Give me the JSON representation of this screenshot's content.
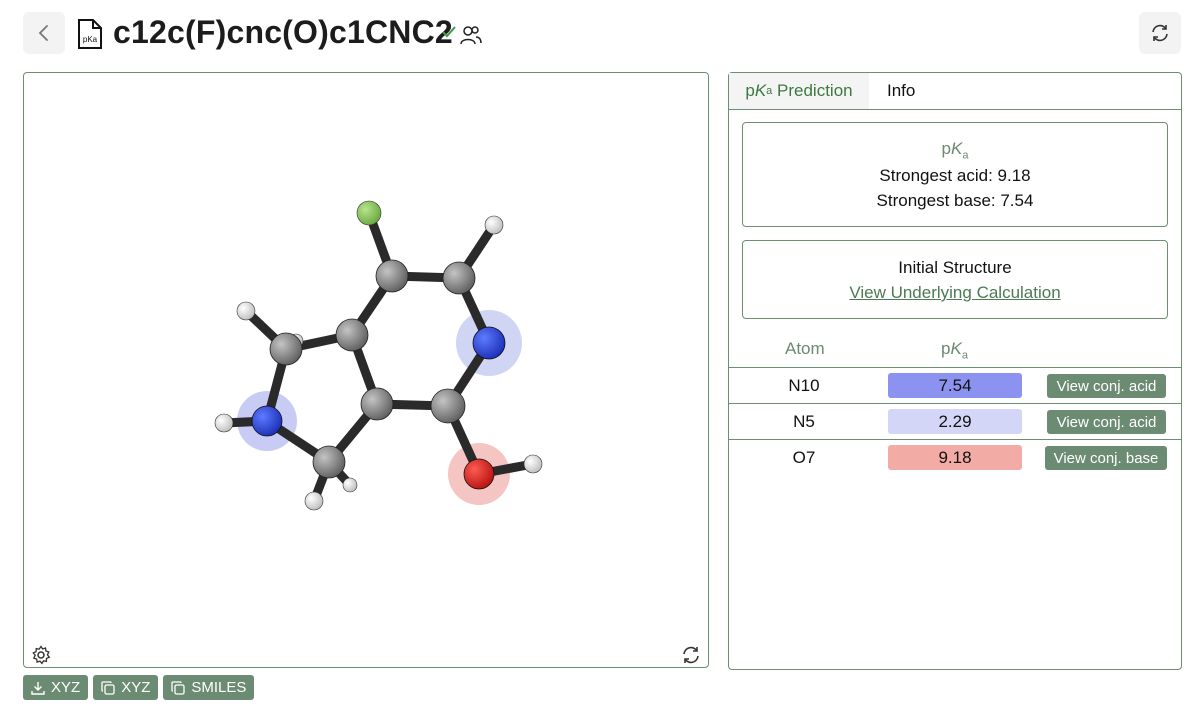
{
  "header": {
    "title": "c12c(F)cnc(O)c1CNC2",
    "file_icon_text": "pKa"
  },
  "bottom_buttons": [
    {
      "label": "XYZ",
      "icon": "download-icon"
    },
    {
      "label": "XYZ",
      "icon": "copy-icon"
    },
    {
      "label": "SMILES",
      "icon": "copy-icon"
    }
  ],
  "tabs": {
    "active_prefix": "p",
    "active_k": "K",
    "active_sub": "a",
    "active_suffix": " Prediction",
    "info": "Info"
  },
  "summary": {
    "head_p": "p",
    "head_k": "K",
    "head_sub": "a",
    "strongest_acid": "Strongest acid: 9.18",
    "strongest_base": "Strongest base: 7.54"
  },
  "initial": {
    "title": "Initial Structure",
    "link": "View Underlying Calculation"
  },
  "table": {
    "col_atom": "Atom",
    "col_pka_p": "p",
    "col_pka_k": "K",
    "col_pka_sub": "a",
    "rows": [
      {
        "atom": "N10",
        "pka": "7.54",
        "pill_color": "#8c92f0",
        "action": "View conj. acid"
      },
      {
        "atom": "N5",
        "pka": "2.29",
        "pill_color": "#d4d6f8",
        "action": "View conj. acid"
      },
      {
        "atom": "O7",
        "pka": "9.18",
        "pill_color": "#f3aba6",
        "action": "View conj. base"
      }
    ]
  },
  "colors": {
    "accent": "#6c8b73",
    "accent_text": "#3d7a3f",
    "nitrogen": "#2340d8",
    "oxygen": "#d8201c",
    "fluorine": "#86c45a",
    "carbon": "#8a8a8a"
  }
}
